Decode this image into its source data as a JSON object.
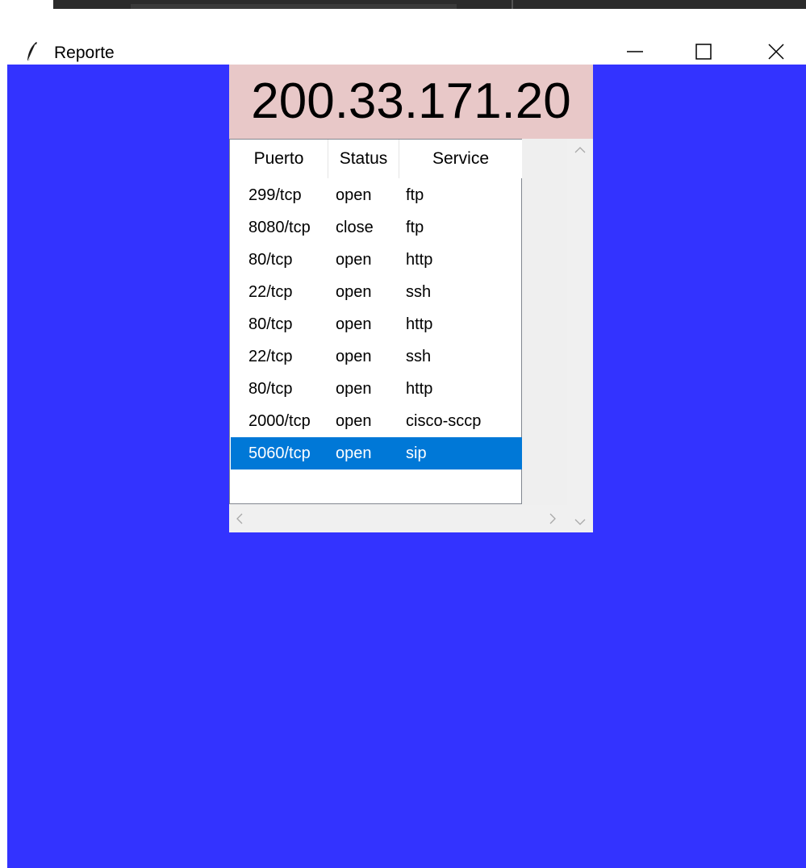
{
  "window": {
    "title": "Reporte",
    "minimize_icon": "minimize-icon",
    "maximize_icon": "maximize-icon",
    "close_icon": "close-icon"
  },
  "colors": {
    "background": "#3333ff",
    "header_bg": "#e8c8c8",
    "selection": "#0078d7"
  },
  "header": {
    "ip": "200.33.171.20"
  },
  "table": {
    "columns": [
      "Puerto",
      "Status",
      "Service"
    ],
    "rows": [
      [
        "299/tcp",
        "open",
        "ftp"
      ],
      [
        "8080/tcp",
        "close",
        "ftp"
      ],
      [
        "80/tcp",
        "open",
        "http"
      ],
      [
        "22/tcp",
        "open",
        "ssh"
      ],
      [
        "80/tcp",
        "open",
        "http"
      ],
      [
        "22/tcp",
        "open",
        "ssh"
      ],
      [
        "80/tcp",
        "open",
        "http"
      ],
      [
        "2000/tcp",
        "open",
        "cisco-sccp"
      ],
      [
        "5060/tcp",
        "open",
        "sip"
      ]
    ],
    "selected_row": 8
  },
  "scrollbars": {
    "up_icon": "chevron-up-icon",
    "down_icon": "chevron-down-icon",
    "left_icon": "chevron-left-icon",
    "right_icon": "chevron-right-icon"
  }
}
